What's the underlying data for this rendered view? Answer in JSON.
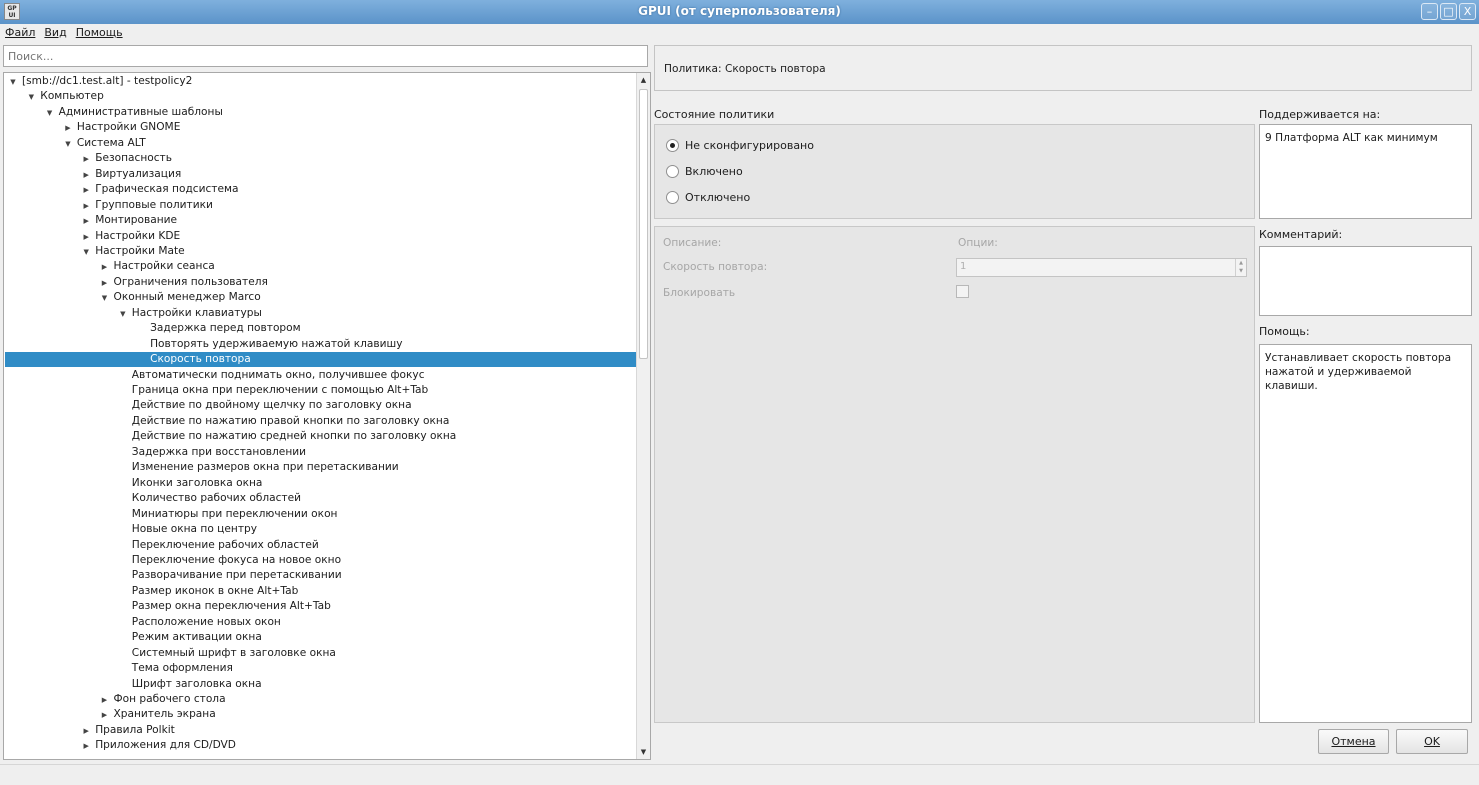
{
  "window": {
    "title": "GPUI (от суперпользователя)",
    "app_icon_text": "GP UI",
    "controls": {
      "minimize": "–",
      "maximize": "□",
      "close": "X"
    }
  },
  "menu": [
    "Файл",
    "Вид",
    "Помощь"
  ],
  "search": {
    "placeholder": "Поиск..."
  },
  "tree": {
    "items": [
      {
        "label": "[smb://dc1.test.alt] - testpolicy2",
        "level": 0,
        "arrow": "expanded"
      },
      {
        "label": "Компьютер",
        "level": 1,
        "arrow": "expanded"
      },
      {
        "label": "Административные шаблоны",
        "level": 2,
        "arrow": "expanded"
      },
      {
        "label": "Настройки GNOME",
        "level": 3,
        "arrow": "collapsed"
      },
      {
        "label": "Система ALT",
        "level": 3,
        "arrow": "expanded"
      },
      {
        "label": "Безопасность",
        "level": 4,
        "arrow": "collapsed"
      },
      {
        "label": "Виртуализация",
        "level": 4,
        "arrow": "collapsed"
      },
      {
        "label": "Графическая подсистема",
        "level": 4,
        "arrow": "collapsed"
      },
      {
        "label": "Групповые политики",
        "level": 4,
        "arrow": "collapsed"
      },
      {
        "label": "Монтирование",
        "level": 4,
        "arrow": "collapsed"
      },
      {
        "label": "Настройки KDE",
        "level": 4,
        "arrow": "collapsed"
      },
      {
        "label": "Настройки Mate",
        "level": 4,
        "arrow": "expanded"
      },
      {
        "label": "Настройки сеанса",
        "level": 5,
        "arrow": "collapsed"
      },
      {
        "label": "Ограничения пользователя",
        "level": 5,
        "arrow": "collapsed"
      },
      {
        "label": "Оконный менеджер Marco",
        "level": 5,
        "arrow": "expanded"
      },
      {
        "label": "Настройки клавиатуры",
        "level": 6,
        "arrow": "expanded"
      },
      {
        "label": "Задержка перед повтором",
        "level": 7,
        "arrow": "none"
      },
      {
        "label": "Повторять удерживаемую нажатой клавишу",
        "level": 7,
        "arrow": "none"
      },
      {
        "label": "Скорость повтора",
        "level": 7,
        "arrow": "none",
        "selected": true
      },
      {
        "label": "Автоматически поднимать окно, получившее фокус",
        "level": 6,
        "arrow": "none"
      },
      {
        "label": "Граница окна при переключении с помощью Alt+Tab",
        "level": 6,
        "arrow": "none"
      },
      {
        "label": "Действие по двойному щелчку по заголовку окна",
        "level": 6,
        "arrow": "none"
      },
      {
        "label": "Действие по нажатию правой кнопки по заголовку окна",
        "level": 6,
        "arrow": "none"
      },
      {
        "label": "Действие по нажатию средней кнопки по заголовку окна",
        "level": 6,
        "arrow": "none"
      },
      {
        "label": "Задержка при восстановлении",
        "level": 6,
        "arrow": "none"
      },
      {
        "label": "Изменение размеров окна при перетаскивании",
        "level": 6,
        "arrow": "none"
      },
      {
        "label": "Иконки заголовка окна",
        "level": 6,
        "arrow": "none"
      },
      {
        "label": "Количество рабочих областей",
        "level": 6,
        "arrow": "none"
      },
      {
        "label": "Миниатюры при переключении окон",
        "level": 6,
        "arrow": "none"
      },
      {
        "label": "Новые окна по центру",
        "level": 6,
        "arrow": "none"
      },
      {
        "label": "Переключение рабочих областей",
        "level": 6,
        "arrow": "none"
      },
      {
        "label": "Переключение фокуса на новое окно",
        "level": 6,
        "arrow": "none"
      },
      {
        "label": "Разворачивание при перетаскивании",
        "level": 6,
        "arrow": "none"
      },
      {
        "label": "Размер иконок в окне Alt+Tab",
        "level": 6,
        "arrow": "none"
      },
      {
        "label": "Размер окна переключения Alt+Tab",
        "level": 6,
        "arrow": "none"
      },
      {
        "label": "Расположение новых окон",
        "level": 6,
        "arrow": "none"
      },
      {
        "label": "Режим активации окна",
        "level": 6,
        "arrow": "none"
      },
      {
        "label": "Системный шрифт в заголовке окна",
        "level": 6,
        "arrow": "none"
      },
      {
        "label": "Тема оформления",
        "level": 6,
        "arrow": "none"
      },
      {
        "label": "Шрифт заголовка окна",
        "level": 6,
        "arrow": "none"
      },
      {
        "label": "Фон рабочего стола",
        "level": 5,
        "arrow": "collapsed"
      },
      {
        "label": "Хранитель экрана",
        "level": 5,
        "arrow": "collapsed"
      },
      {
        "label": "Правила Polkit",
        "level": 4,
        "arrow": "collapsed"
      },
      {
        "label": "Приложения для CD/DVD",
        "level": 4,
        "arrow": "collapsed"
      }
    ]
  },
  "policy": {
    "header": "Политика: Скорость повтора"
  },
  "state": {
    "title": "Состояние политики",
    "options": [
      {
        "label": "Не сконфигурировано",
        "checked": true
      },
      {
        "label": "Включено",
        "checked": false
      },
      {
        "label": "Отключено",
        "checked": false
      }
    ]
  },
  "options_panel": {
    "description_label": "Описание:",
    "options_label": "Опции:",
    "repeat_rate_label": "Скорость повтора:",
    "repeat_rate_value": "1",
    "lock_label": "Блокировать"
  },
  "side": {
    "supported_label": "Поддерживается на:",
    "supported_value": "9 Платформа ALT как минимум",
    "comment_label": "Комментарий:",
    "comment_value": "",
    "help_label": "Помощь:",
    "help_value": "Устанавливает скорость повтора нажатой и удерживаемой клавиши."
  },
  "buttons": {
    "cancel": "Отмена",
    "ok": "OK"
  }
}
